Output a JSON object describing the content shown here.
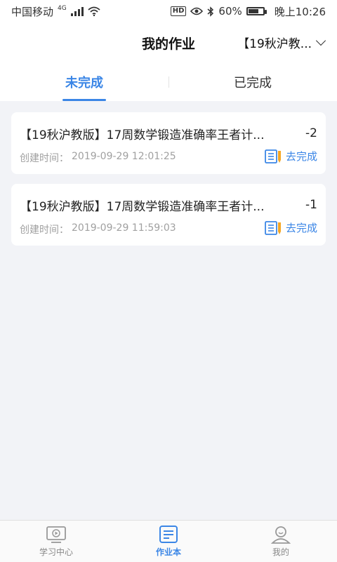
{
  "status_bar": {
    "carrier": "中国移动",
    "network": "4G",
    "battery": "60%",
    "time": "晚上10:26"
  },
  "header": {
    "title": "我的作业",
    "term_selector": "【19秋沪教..."
  },
  "tabs": [
    {
      "label": "未完成",
      "active": true
    },
    {
      "label": "已完成",
      "active": false
    }
  ],
  "homework": [
    {
      "title": "【19秋沪教版】17周数学锻造准确率王者计...",
      "score": "-2",
      "created_label": "创建时间：",
      "created_time": "2019-09-29 12:01:25",
      "action": "去完成"
    },
    {
      "title": "【19秋沪教版】17周数学锻造准确率王者计...",
      "score": "-1",
      "created_label": "创建时间：",
      "created_time": "2019-09-29 11:59:03",
      "action": "去完成"
    }
  ],
  "tabbar": [
    {
      "label": "学习中心",
      "icon": "video-screen-icon",
      "active": false
    },
    {
      "label": "作业本",
      "icon": "notes-icon",
      "active": true
    },
    {
      "label": "我的",
      "icon": "user-icon",
      "active": false
    }
  ],
  "colors": {
    "accent": "#3b86e6",
    "background": "#f2f3f7",
    "muted_text": "#a0a0a0"
  }
}
